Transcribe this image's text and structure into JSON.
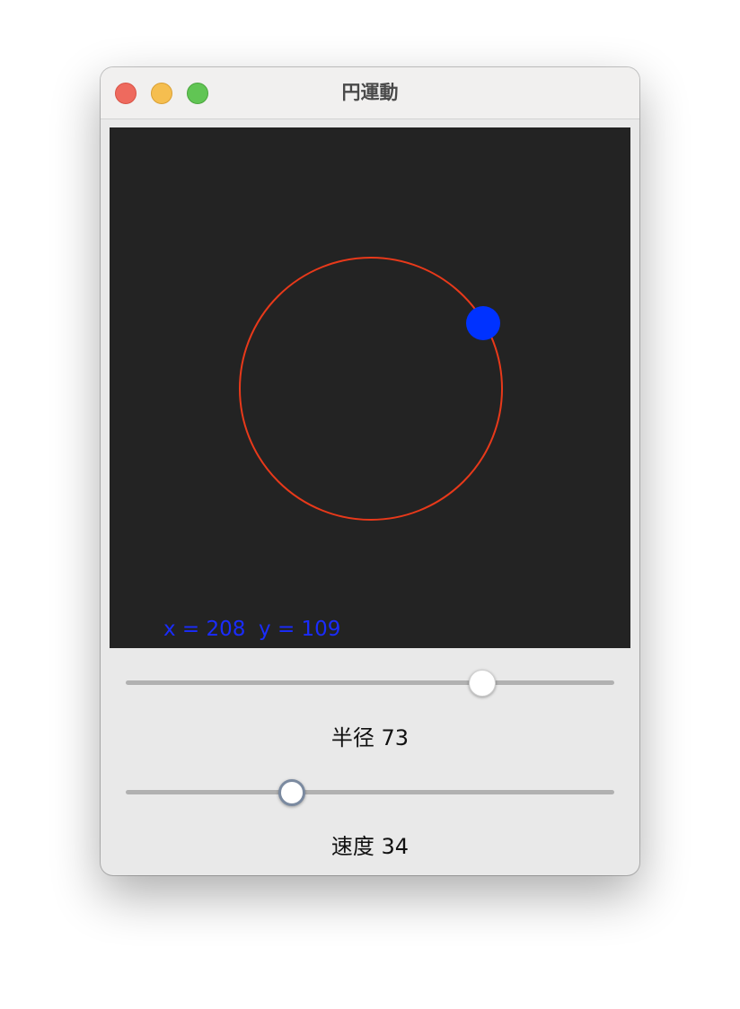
{
  "window": {
    "title": "円運動"
  },
  "canvas": {
    "background": "#232323",
    "orbit_color": "#e8391a",
    "ball_color": "#0032ff",
    "readout_color": "#1a2cff",
    "coord_readout": "x = 208  y = 109"
  },
  "sliders": {
    "radius": {
      "label": "半径 73",
      "value_fraction": 0.73
    },
    "speed": {
      "label": "速度 34",
      "value_fraction": 0.34
    }
  }
}
